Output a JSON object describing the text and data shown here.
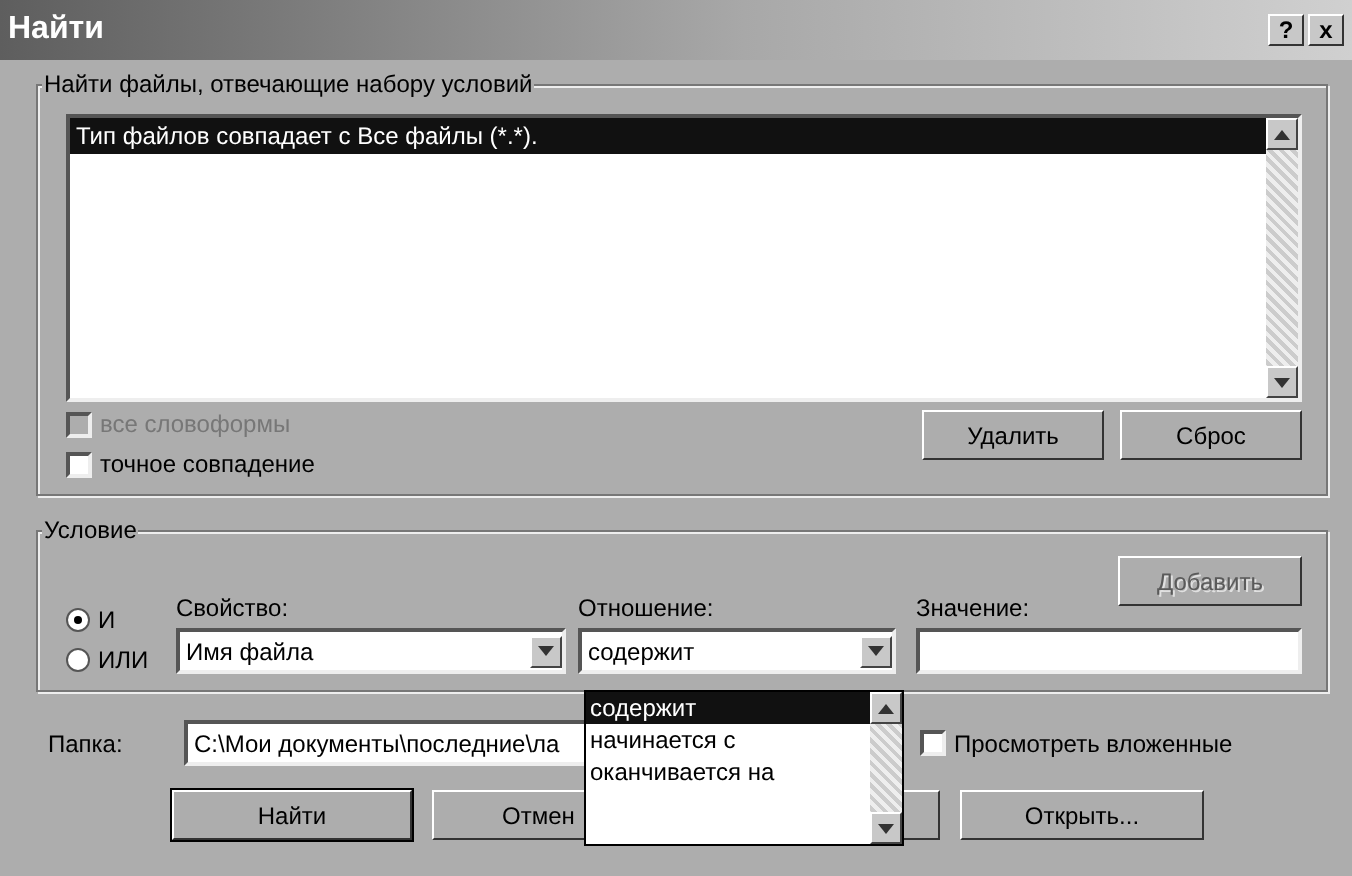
{
  "window": {
    "title": "Найти",
    "help_button": "?",
    "close_button": "x"
  },
  "criteria": {
    "label": "Найти файлы, отвечающие набору условий",
    "items": [
      {
        "text": "Тип файлов совпадает с Все файлы (*.*).",
        "selected": true
      }
    ],
    "checkboxes": [
      {
        "label": "все словоформы",
        "checked": false,
        "disabled": true
      },
      {
        "label": "точное совпадение",
        "checked": false,
        "disabled": false
      }
    ],
    "buttons": [
      "Удалить",
      "Сброс"
    ]
  },
  "condition": {
    "label": "Условие",
    "add_button": {
      "label": "Добавить",
      "disabled": true
    },
    "radios": [
      {
        "label": "И",
        "selected": true
      },
      {
        "label": "ИЛИ",
        "selected": false
      }
    ],
    "property": {
      "label": "Свойство:",
      "value": "Имя файла"
    },
    "relation": {
      "label": "Отношение:",
      "value": "содержит",
      "options": [
        {
          "text": "содержит",
          "selected": true
        },
        {
          "text": "начинается с",
          "selected": false
        },
        {
          "text": "оканчивается на",
          "selected": false
        }
      ]
    },
    "value": {
      "label": "Значение:"
    }
  },
  "folder": {
    "label": "Папка:",
    "value": "C:\\Мои документы\\последние\\ла"
  },
  "subfolders": {
    "label": "Просмотреть вложенные",
    "checked": false
  },
  "buttons": [
    {
      "kind": "default",
      "label": "Найти"
    },
    {
      "kind": "normal",
      "label": "Отмен"
    },
    {
      "kind": "covered"
    },
    {
      "kind": "normal",
      "label": "Открыть..."
    }
  ]
}
